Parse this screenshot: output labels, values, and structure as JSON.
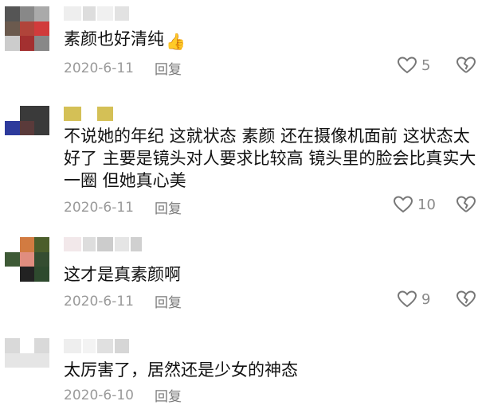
{
  "comments": [
    {
      "text": "素颜也好清纯",
      "emoji": "👍",
      "date": "2020-6-11",
      "reply": "回复",
      "likes": "5",
      "avatar_colors": [
        "#555555",
        "#888888",
        "#aaaaaa",
        "#6b5a4e",
        "#b0443a",
        "#d13b3b",
        "#cccccc",
        "#a33030",
        "#888888"
      ],
      "name_colors": [
        "#eeeeee",
        "#dddddd",
        "#f0f0f0",
        "#e2e2e2"
      ]
    },
    {
      "text": "不说她的年纪 这就状态 素颜 还在摄像机面前 这状态太好了 主要是镜头对人要求比较高 镜头里的脸会比真实大一圈 但她真心美",
      "emoji": "",
      "date": "2020-6-11",
      "reply": "回复",
      "likes": "10",
      "avatar_colors": [
        "#ffffff",
        "#3a3a3a",
        "#3a3a3a",
        "#2d3a9c",
        "#5a3a3a",
        "#3a3a3a",
        "#ffffff",
        "#ffffff",
        "#ffffff"
      ],
      "name_colors": [
        "#d4c056",
        "#ffffff",
        "#d4c056"
      ]
    },
    {
      "text": "这才是真素颜啊",
      "emoji": "",
      "date": "2020-6-11",
      "reply": "回复",
      "likes": "9",
      "avatar_colors": [
        "#ffffff",
        "#d27b41",
        "#4b5e2b",
        "#3e5a36",
        "#e08d7f",
        "#354d31",
        "#ffffff",
        "#222222",
        "#2e4a2e"
      ],
      "name_colors": [
        "#f2e8ea",
        "#dddddd",
        "#cccccc",
        "#e5e5e5",
        "#d0d0d0"
      ]
    },
    {
      "text": "太厉害了，居然还是少女的神态",
      "emoji": "",
      "date": "2020-6-10",
      "reply": "回复",
      "likes": "",
      "avatar_colors": [
        "#d9d9d9",
        "#ffffff",
        "#d9d9d9",
        "#e5e5e5",
        "#e5e5e5",
        "#e5e5e5",
        "#ffffff",
        "#ffffff",
        "#ffffff"
      ],
      "name_colors": [
        "#eeeeee",
        "#f3f3f3",
        "#e0e0e0",
        "#d6d6d6"
      ]
    }
  ]
}
